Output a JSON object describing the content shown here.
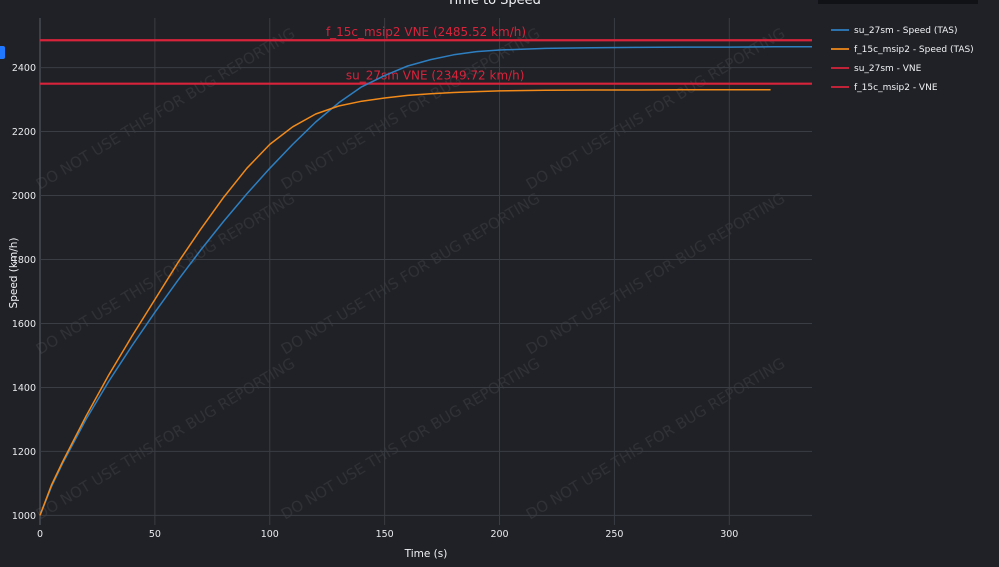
{
  "chart_data": {
    "type": "line",
    "title": "Time to Speed",
    "xlabel": "Time (s)",
    "ylabel": "Speed (km/h)",
    "xlim": [
      0,
      336
    ],
    "ylim": [
      970,
      2555
    ],
    "x_ticks": [
      0,
      50,
      100,
      150,
      200,
      250,
      300
    ],
    "y_ticks": [
      1000,
      1200,
      1400,
      1600,
      1800,
      2000,
      2200,
      2400
    ],
    "grid": true,
    "legend_position": "right",
    "series": [
      {
        "name": "su_27sm - Speed (TAS)",
        "color": "#2e7fc1",
        "x": [
          0,
          5,
          10,
          20,
          30,
          40,
          50,
          60,
          70,
          80,
          90,
          100,
          110,
          120,
          130,
          140,
          150,
          160,
          170,
          180,
          190,
          200,
          220,
          240,
          260,
          280,
          300,
          320,
          336
        ],
        "y": [
          1000,
          1090,
          1165,
          1300,
          1420,
          1530,
          1635,
          1735,
          1830,
          1920,
          2005,
          2085,
          2160,
          2230,
          2290,
          2340,
          2375,
          2405,
          2425,
          2440,
          2450,
          2455,
          2460,
          2462,
          2463,
          2464,
          2464,
          2465,
          2465
        ]
      },
      {
        "name": "f_15c_msip2 - Speed (TAS)",
        "color": "#f28a1a",
        "x": [
          0,
          5,
          10,
          20,
          30,
          40,
          50,
          60,
          70,
          80,
          90,
          100,
          110,
          120,
          130,
          140,
          150,
          160,
          170,
          180,
          190,
          200,
          220,
          240,
          260,
          280,
          300,
          318
        ],
        "y": [
          1000,
          1095,
          1170,
          1310,
          1440,
          1560,
          1675,
          1790,
          1895,
          1995,
          2085,
          2160,
          2215,
          2255,
          2280,
          2295,
          2305,
          2313,
          2318,
          2322,
          2325,
          2327,
          2329,
          2330,
          2330,
          2331,
          2331,
          2331
        ]
      }
    ],
    "reference_lines": [
      {
        "name": "su_27sm - VNE",
        "color": "#d8233b",
        "y": 2349.72,
        "label": "su_27sm VNE (2349.72 km/h)",
        "label_x": 172
      },
      {
        "name": "f_15c_msip2 - VNE",
        "color": "#d8233b",
        "y": 2485.52,
        "label": "f_15c_msip2 VNE (2485.52 km/h)",
        "label_x": 168
      }
    ]
  },
  "watermark": "DO NOT USE THIS FOR BUG REPORTING"
}
